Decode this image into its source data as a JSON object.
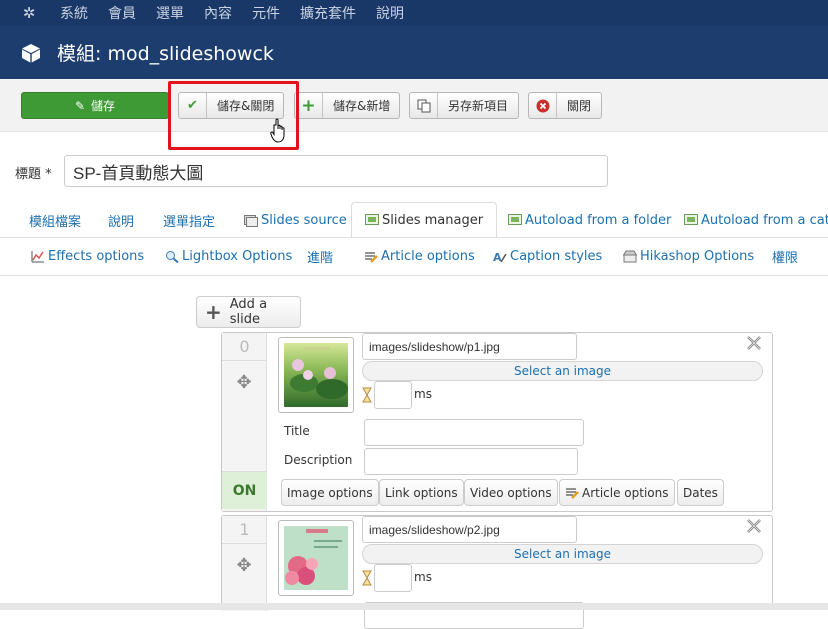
{
  "topnav": {
    "items": [
      "系統",
      "會員",
      "選單",
      "內容",
      "元件",
      "擴充套件",
      "說明"
    ]
  },
  "header": {
    "title": "模組: mod_slideshowck"
  },
  "toolbar": {
    "save": "儲存",
    "save_close": "儲存&關閉",
    "save_new": "儲存&新增",
    "save_copy": "另存新項目",
    "close": "關閉"
  },
  "form": {
    "title_label": "標題",
    "title_required": "*",
    "title_value": "SP-首頁動態大圖"
  },
  "tabs_row1": [
    "模組檔案",
    "說明",
    "選單指定",
    "Slides source",
    "Slides manager",
    "Autoload from a folder",
    "Autoload from a categ"
  ],
  "tabs_row2": [
    "Effects options",
    "Lightbox Options",
    "進階",
    "Article options",
    "Caption styles",
    "Hikashop Options",
    "權限"
  ],
  "add_slide_label": "Add a slide",
  "slides": [
    {
      "index": "0",
      "path": "images/slideshow/p1.jpg",
      "select_image": "Select an image",
      "ms_label": "ms",
      "title_label": "Title",
      "description_label": "Description",
      "status": "ON",
      "options": [
        "Image options",
        "Link options",
        "Video options",
        "Article options",
        "Dates"
      ]
    },
    {
      "index": "1",
      "path": "images/slideshow/p2.jpg",
      "select_image": "Select an image",
      "ms_label": "ms"
    }
  ],
  "colors": {
    "topnav_bg": "#1a3867",
    "header_bg": "#1c3d6e",
    "save_green": "#3e9a35",
    "highlight_red": "#e3131b",
    "link_blue": "#1d6fae"
  }
}
